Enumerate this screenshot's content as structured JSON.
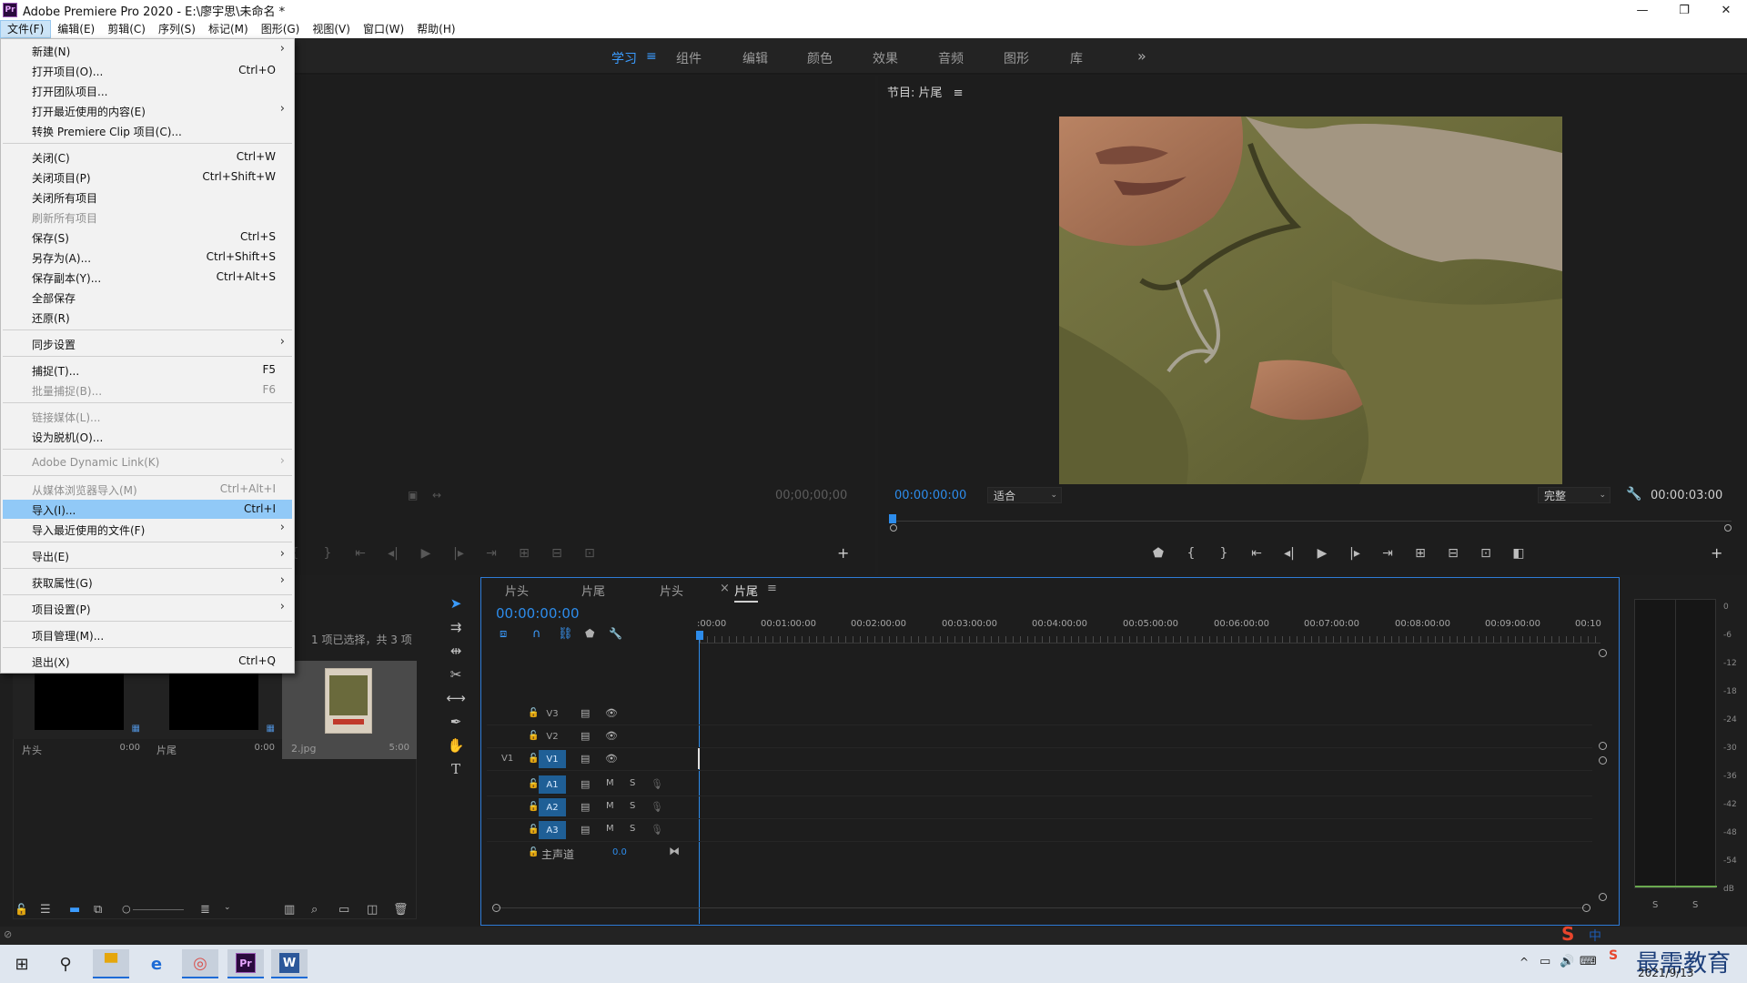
{
  "titlebar": {
    "app_icon_text": "Pr",
    "title": "Adobe Premiere Pro 2020 - E:\\廖宇思\\未命名 *",
    "minimize": "—",
    "maximize": "❐",
    "close": "✕"
  },
  "menubar": {
    "items": [
      "文件(F)",
      "编辑(E)",
      "剪辑(C)",
      "序列(S)",
      "标记(M)",
      "图形(G)",
      "视图(V)",
      "窗口(W)",
      "帮助(H)"
    ]
  },
  "workspaces": {
    "items": [
      "学习",
      "组件",
      "编辑",
      "颜色",
      "效果",
      "音频",
      "图形",
      "库"
    ],
    "active_index": 0,
    "more": "»"
  },
  "file_menu": {
    "items": [
      {
        "label": "新建(N)",
        "shortcut": "",
        "submenu": true,
        "disabled": false
      },
      {
        "label": "打开项目(O)...",
        "shortcut": "Ctrl+O",
        "submenu": false,
        "disabled": false
      },
      {
        "label": "打开团队项目...",
        "shortcut": "",
        "submenu": false,
        "disabled": false
      },
      {
        "label": "打开最近使用的内容(E)",
        "shortcut": "",
        "submenu": true,
        "disabled": false
      },
      {
        "label": "转换 Premiere Clip 项目(C)...",
        "shortcut": "",
        "submenu": false,
        "disabled": false
      },
      {
        "label": "关闭(C)",
        "shortcut": "Ctrl+W",
        "submenu": false,
        "disabled": false
      },
      {
        "label": "关闭项目(P)",
        "shortcut": "Ctrl+Shift+W",
        "submenu": false,
        "disabled": false
      },
      {
        "label": "关闭所有项目",
        "shortcut": "",
        "submenu": false,
        "disabled": false
      },
      {
        "label": "刷新所有项目",
        "shortcut": "",
        "submenu": false,
        "disabled": true
      },
      {
        "label": "保存(S)",
        "shortcut": "Ctrl+S",
        "submenu": false,
        "disabled": false
      },
      {
        "label": "另存为(A)...",
        "shortcut": "Ctrl+Shift+S",
        "submenu": false,
        "disabled": false
      },
      {
        "label": "保存副本(Y)...",
        "shortcut": "Ctrl+Alt+S",
        "submenu": false,
        "disabled": false
      },
      {
        "label": "全部保存",
        "shortcut": "",
        "submenu": false,
        "disabled": false
      },
      {
        "label": "还原(R)",
        "shortcut": "",
        "submenu": false,
        "disabled": false
      },
      {
        "label": "同步设置",
        "shortcut": "",
        "submenu": true,
        "disabled": false
      },
      {
        "label": "捕捉(T)...",
        "shortcut": "F5",
        "submenu": false,
        "disabled": false
      },
      {
        "label": "批量捕捉(B)...",
        "shortcut": "F6",
        "submenu": false,
        "disabled": true
      },
      {
        "label": "链接媒体(L)...",
        "shortcut": "",
        "submenu": false,
        "disabled": true
      },
      {
        "label": "设为脱机(O)...",
        "shortcut": "",
        "submenu": false,
        "disabled": false
      },
      {
        "label": "Adobe Dynamic Link(K)",
        "shortcut": "",
        "submenu": true,
        "disabled": true
      },
      {
        "label": "从媒体浏览器导入(M)",
        "shortcut": "Ctrl+Alt+I",
        "submenu": false,
        "disabled": true
      },
      {
        "label": "导入(I)...",
        "shortcut": "Ctrl+I",
        "submenu": false,
        "disabled": false
      },
      {
        "label": "导入最近使用的文件(F)",
        "shortcut": "",
        "submenu": true,
        "disabled": false
      },
      {
        "label": "导出(E)",
        "shortcut": "",
        "submenu": true,
        "disabled": false
      },
      {
        "label": "获取属性(G)",
        "shortcut": "",
        "submenu": true,
        "disabled": false
      },
      {
        "label": "项目设置(P)",
        "shortcut": "",
        "submenu": true,
        "disabled": false
      },
      {
        "label": "项目管理(M)...",
        "shortcut": "",
        "submenu": false,
        "disabled": false
      },
      {
        "label": "退出(X)",
        "shortcut": "Ctrl+Q",
        "submenu": false,
        "disabled": false
      }
    ],
    "highlighted_index": 21
  },
  "source_monitor": {
    "timecode": "00;00;00;00"
  },
  "program_monitor": {
    "title": "节目: 片尾",
    "menu_icon": "≡",
    "timecode": "00:00:00:00",
    "fit": "适合",
    "quality": "完整",
    "duration": "00:00:03:00"
  },
  "project_panel": {
    "selection_info": "1 项已选择，共 3 项",
    "items": [
      {
        "name": "片头",
        "duration": "0:00"
      },
      {
        "name": "片尾",
        "duration": "0:00"
      },
      {
        "name": "2.jpg",
        "duration": "5:00"
      }
    ]
  },
  "timeline": {
    "tabs": [
      "片头",
      "片尾",
      "片头",
      "片尾"
    ],
    "active_tab_index": 3,
    "close_glyph": "×",
    "menu_glyph": "≡",
    "timecode": "00:00:00:00",
    "ruler": [
      ":00:00",
      "00:01:00:00",
      "00:02:00:00",
      "00:03:00:00",
      "00:04:00:00",
      "00:05:00:00",
      "00:06:00:00",
      "00:07:00:00",
      "00:08:00:00",
      "00:09:00:00",
      "00:10"
    ],
    "video_tracks": [
      {
        "name": "V3",
        "src": "",
        "targeted": false
      },
      {
        "name": "V2",
        "src": "",
        "targeted": false
      },
      {
        "name": "V1",
        "src": "V1",
        "targeted": true
      }
    ],
    "audio_tracks": [
      {
        "name": "A1",
        "m": "M",
        "s": "S"
      },
      {
        "name": "A2",
        "m": "M",
        "s": "S"
      },
      {
        "name": "A3",
        "m": "M",
        "s": "S"
      }
    ],
    "master": {
      "name": "主声道",
      "value": "0.0"
    }
  },
  "audio_meter": {
    "scale": [
      "0",
      "-6",
      "-12",
      "-18",
      "-24",
      "-30",
      "-36",
      "-42",
      "-48",
      "-54",
      "dB"
    ],
    "solo_left": "S",
    "solo_right": "S"
  },
  "taskbar": {
    "clock_time": "",
    "clock_date": "2021/9/13",
    "ime": "中",
    "watermark": "最需教育"
  },
  "colors": {
    "accent_blue": "#2d8ceb",
    "menu_highlight": "#91c9f7",
    "timeline_border": "#2e7bd6"
  }
}
